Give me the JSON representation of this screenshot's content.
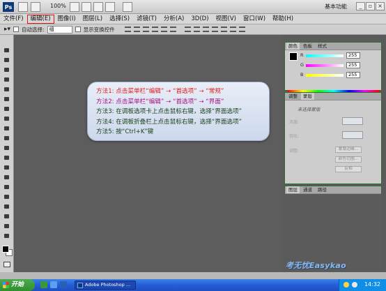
{
  "app": {
    "logo_text": "Ps",
    "zoom": "100%",
    "workspace": "基本功能"
  },
  "menu": [
    "文件(F)",
    "编辑(E)",
    "图像(I)",
    "图层(L)",
    "选择(S)",
    "滤镜(T)",
    "分析(A)",
    "3D(D)",
    "视图(V)",
    "窗口(W)",
    "帮助(H)"
  ],
  "options": {
    "auto_select_label": "自动选择:",
    "auto_select_value": "组",
    "show_transform_label": "显示变换控件"
  },
  "colors_panel": {
    "tabs": [
      "颜色",
      "色板",
      "样式"
    ],
    "r_label": "R",
    "r_value": "255",
    "g_label": "G",
    "g_value": "255",
    "b_label": "B",
    "b_value": "255"
  },
  "adjust_panel": {
    "tabs": [
      "调整",
      "蒙版"
    ],
    "title": "未选择蒙版",
    "density_label": "浓度:",
    "feather_label": "羽化:",
    "refine_label": "调整:",
    "btn_edge": "蒙版边缘...",
    "btn_color_range": "颜色范围...",
    "btn_invert": "反相"
  },
  "layers_panel": {
    "tabs": [
      "图层",
      "通道",
      "路径"
    ]
  },
  "callout": {
    "lines": [
      {
        "text": "方法1: 点击菜单栏“编辑” → “首选项” → “常规”",
        "color": "#e11a1a"
      },
      {
        "text": "方法2: 点击菜单栏“编辑” → “首选项” → “界面”",
        "color": "#a6127a"
      },
      {
        "text": "方法3: 在调板选项卡上点击鼠标右键，选择“界面选项”",
        "color": "#173f17"
      },
      {
        "text": "方法4: 在调板折叠栏上点击鼠标右键，选择“界面选项”",
        "color": "#173f17"
      },
      {
        "text": "方法5: 按“Ctrl+K”键",
        "color": "#173f17"
      }
    ]
  },
  "watermark": "考无忧Easykao",
  "taskbar": {
    "start_label": "开始",
    "task_label": "Adobe Photoshop ...",
    "clock": "14:32"
  },
  "accent_colors": {
    "highlight_box": "#e01818",
    "panel_border": "#2f6d2f",
    "taskbar": "#245dd6"
  }
}
